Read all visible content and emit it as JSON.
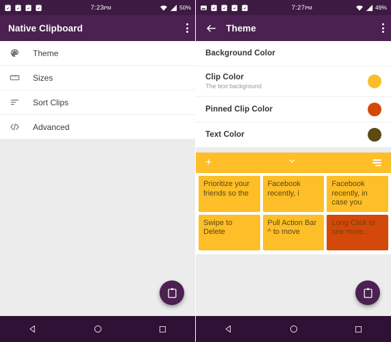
{
  "colors": {
    "app_bar_purple": "#4A2150",
    "status_bar_purple": "#3C1A42",
    "nav_bar_purple": "#2E1135",
    "clip_yellow": "#FDBE28",
    "pinned_orange": "#D2490A",
    "text_olive": "#5C4A12",
    "page_bg": "#ECECEC"
  },
  "left_panel": {
    "status_bar": {
      "time": "7:23",
      "ampm": "PM",
      "battery": "50%",
      "icons": [
        "clipboard-notification-icon",
        "clipboard-notification-icon",
        "clipboard-notification-icon",
        "clipboard-notification-icon"
      ],
      "wifi": "wifi-icon",
      "signal": "signal-icon"
    },
    "app_bar": {
      "title": "Native Clipboard",
      "overflow": "overflow-menu-icon"
    },
    "menu": [
      {
        "label": "Theme",
        "icon": "palette-icon"
      },
      {
        "label": "Sizes",
        "icon": "ruler-icon"
      },
      {
        "label": "Sort Clips",
        "icon": "sort-icon"
      },
      {
        "label": "Advanced",
        "icon": "code-icon"
      }
    ],
    "fab": {
      "icon": "clipboard-icon"
    },
    "nav": [
      "back-nav-icon",
      "home-nav-icon",
      "recents-nav-icon"
    ]
  },
  "right_panel": {
    "status_bar": {
      "time": "7:27",
      "ampm": "PM",
      "battery": "49%",
      "icons": [
        "screenshot-icon",
        "clipboard-notification-icon",
        "clipboard-notification-icon",
        "clipboard-notification-icon",
        "clipboard-notification-icon"
      ],
      "wifi": "wifi-icon",
      "signal": "signal-icon"
    },
    "app_bar": {
      "back": "back-arrow-icon",
      "title": "Theme",
      "overflow": "overflow-menu-icon"
    },
    "preferences": [
      {
        "title": "Background Color",
        "subtitle": "",
        "swatch": ""
      },
      {
        "title": "Clip Color",
        "subtitle": "The text background",
        "swatch": "#FBBE2A"
      },
      {
        "title": "Pinned Clip Color",
        "subtitle": "",
        "swatch": "#D2490A"
      },
      {
        "title": "Text Color",
        "subtitle": "",
        "swatch": "#5C4A12"
      }
    ],
    "action_bar": {
      "add": "+",
      "collapse": "chevron-down-icon",
      "menu": "sort-lines-icon"
    },
    "clips": [
      {
        "text": "Prioritize your friends so the",
        "pinned": false
      },
      {
        "text": "Facebook recently, i",
        "pinned": false
      },
      {
        "text": "Facebook recently, in case you",
        "pinned": false
      },
      {
        "text": "Swipe to Delete",
        "pinned": false
      },
      {
        "text": "Pull Action Bar ^ to move",
        "pinned": false
      },
      {
        "text": "Long Click to see more...",
        "pinned": true
      }
    ],
    "fab": {
      "icon": "clipboard-icon"
    },
    "nav": [
      "back-nav-icon",
      "home-nav-icon",
      "recents-nav-icon"
    ]
  }
}
